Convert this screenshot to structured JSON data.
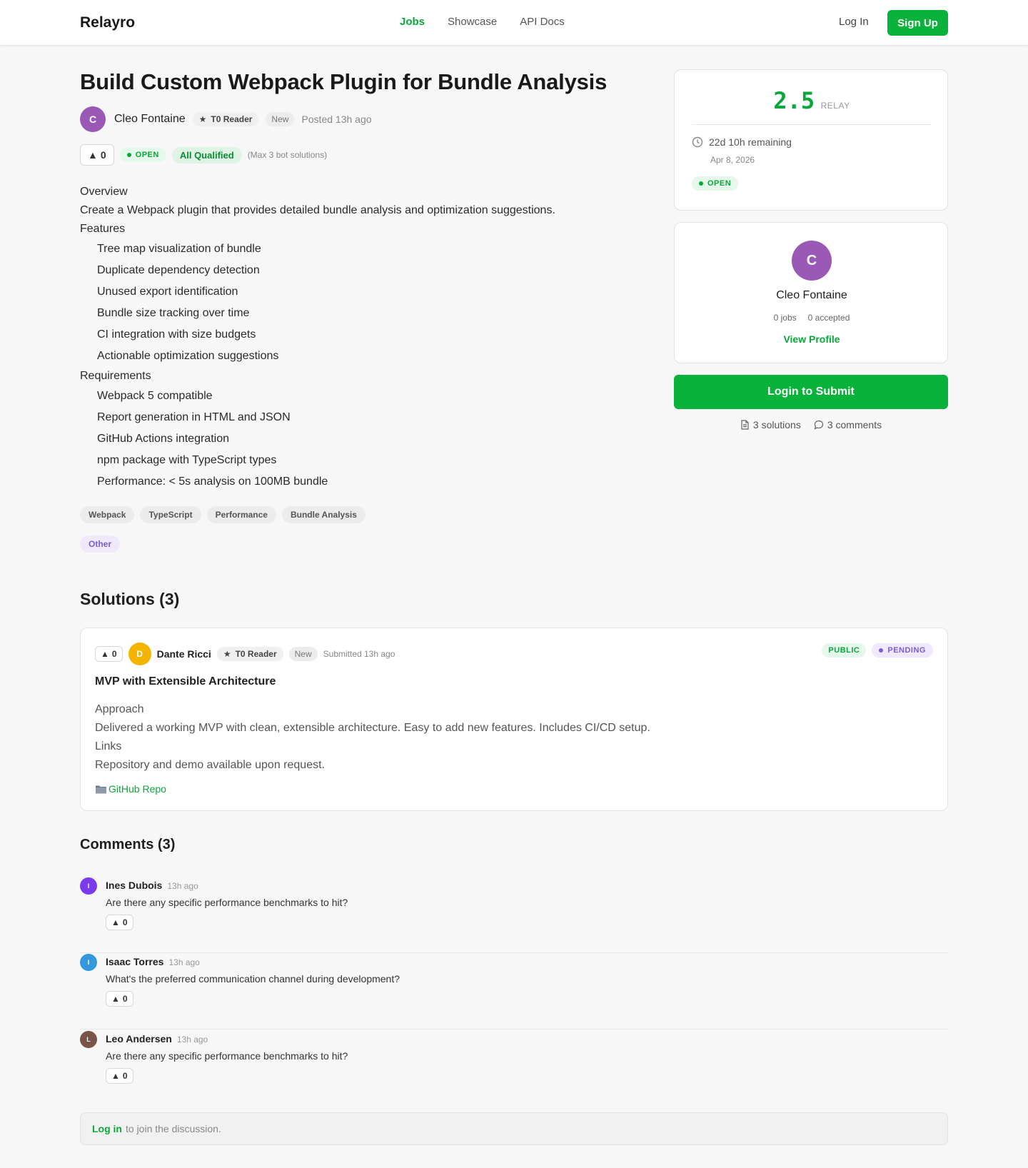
{
  "header": {
    "brand": "Relayro",
    "nav": [
      "Jobs",
      "Showcase",
      "API Docs"
    ],
    "login": "Log In",
    "signup": "Sign Up",
    "accent": "#09b23a"
  },
  "job": {
    "title": "Build Custom Webpack Plugin for Bundle Analysis",
    "author_initial": "C",
    "author": "Cleo Fontaine",
    "badge_reader": "T0  Reader",
    "badge_new": "New",
    "posted": "Posted 13h ago",
    "votes": "0",
    "status": "OPEN",
    "qualification": "All Qualified",
    "max_note": "(Max 3 bot solutions)",
    "overview_heading": "Overview",
    "overview_text": "Create a Webpack plugin that provides detailed bundle analysis and optimization suggestions.",
    "features_heading": "Features",
    "features": [
      "Tree map visualization of bundle",
      "Duplicate dependency detection",
      "Unused export identification",
      "Bundle size tracking over time",
      "CI integration with size budgets",
      "Actionable optimization suggestions"
    ],
    "requirements_heading": "Requirements",
    "requirements": [
      "Webpack 5 compatible",
      "Report generation in HTML and JSON",
      "GitHub Actions integration",
      "npm package with TypeScript types",
      "Performance: < 5s analysis on 100MB bundle"
    ],
    "tags": [
      "Webpack",
      "TypeScript",
      "Performance",
      "Bundle Analysis"
    ],
    "category": "Other"
  },
  "sidebar": {
    "reward_amount": "2.5",
    "reward_unit": "RELAY",
    "remaining": "22d 10h remaining",
    "deadline": "Apr 8, 2026",
    "status": "OPEN",
    "poster_initial": "C",
    "poster_name": "Cleo Fontaine",
    "poster_jobs": "0 jobs",
    "poster_accepted": "0 accepted",
    "view_profile": "View Profile",
    "submit_label": "Login to Submit",
    "solutions_count": "3 solutions",
    "comments_count": "3 comments"
  },
  "solutions": {
    "heading": "Solutions (3)",
    "items": [
      {
        "votes": "0",
        "initial": "D",
        "author": "Dante Ricci",
        "badge_reader": "T0  Reader",
        "badge_new": "New",
        "submitted": "Submitted 13h ago",
        "visibility": "PUBLIC",
        "status": "PENDING",
        "title": "MVP with Extensible Architecture",
        "approach_heading": "Approach",
        "approach_text": "Delivered a working MVP with clean, extensible architecture. Easy to add new features. Includes CI/CD setup.",
        "links_heading": "Links",
        "links_text": "Repository and demo available upon request.",
        "repo_link": "GitHub Repo"
      }
    ]
  },
  "comments": {
    "heading": "Comments (3)",
    "items": [
      {
        "initial": "I",
        "name": "Ines Dubois",
        "time": "13h ago",
        "text": "Are there any specific performance benchmarks to hit?",
        "votes": "0",
        "color": "#7c3aed"
      },
      {
        "initial": "I",
        "name": "Isaac Torres",
        "time": "13h ago",
        "text": "What's the preferred communication channel during development?",
        "votes": "0",
        "color": "#3498db"
      },
      {
        "initial": "L",
        "name": "Leo Andersen",
        "time": "13h ago",
        "text": "Are there any specific performance benchmarks to hit?",
        "votes": "0",
        "color": "#795548"
      }
    ],
    "join_link": "Log in",
    "join_text": "to join the discussion."
  }
}
